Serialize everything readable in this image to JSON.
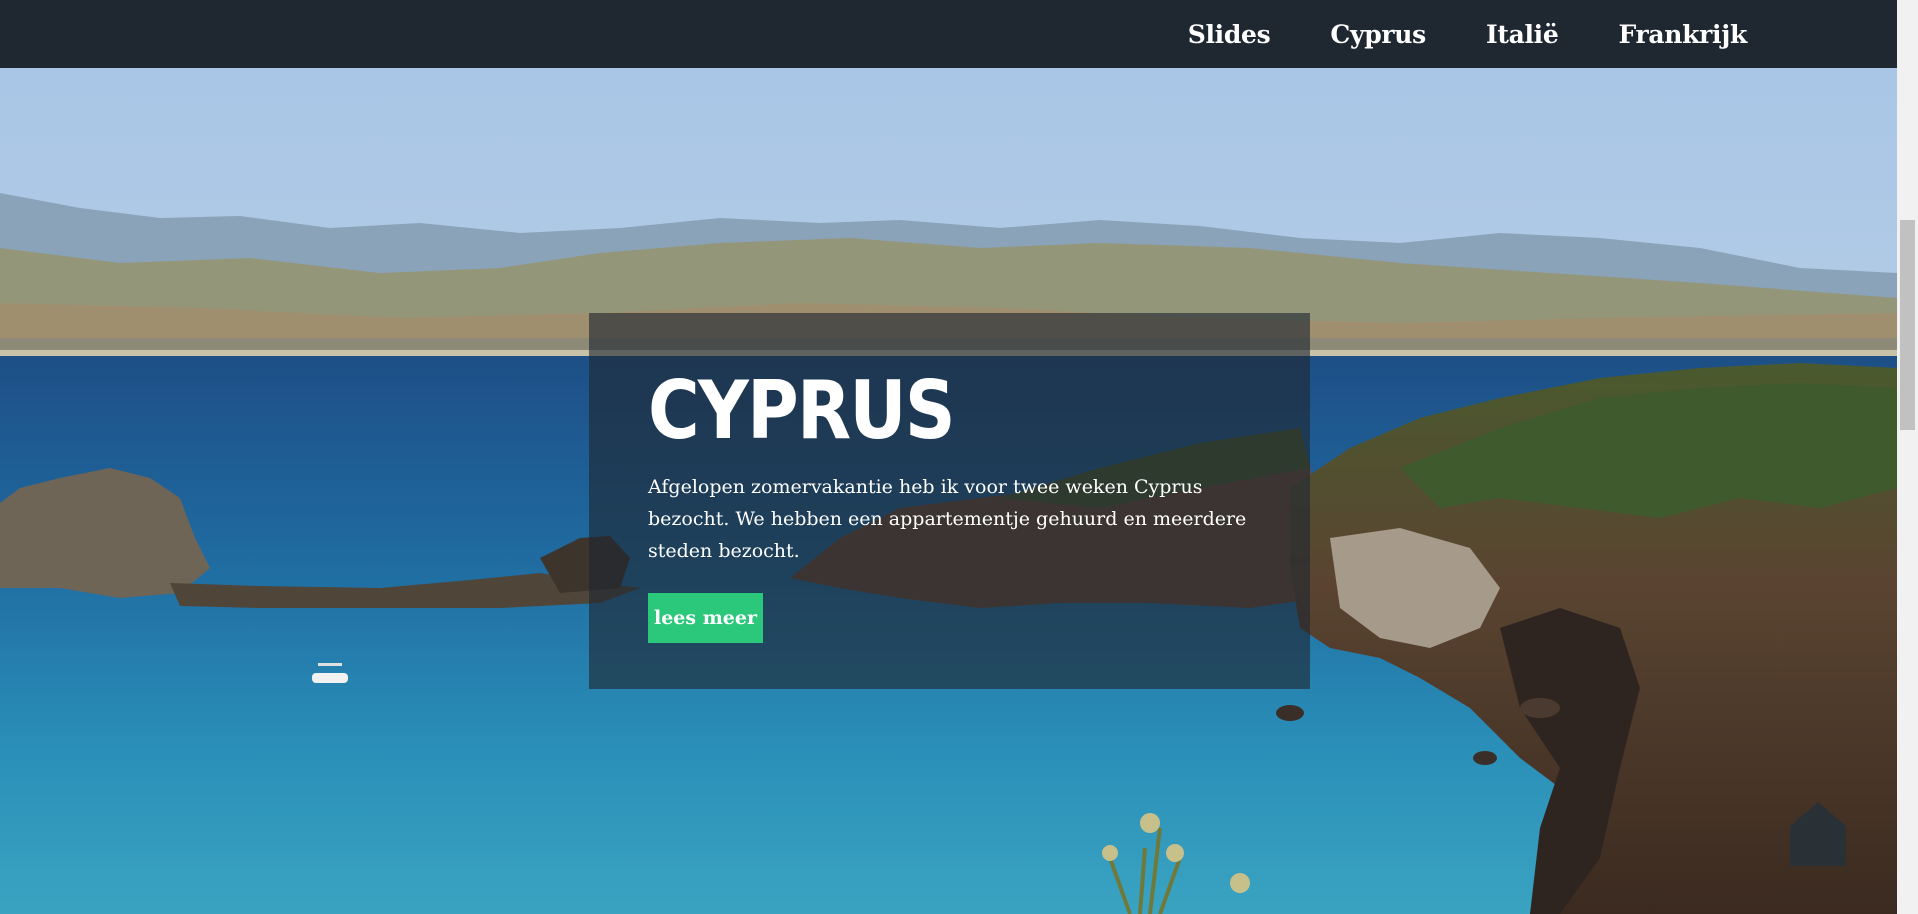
{
  "nav": {
    "items": [
      {
        "label": "Slides"
      },
      {
        "label": "Cyprus"
      },
      {
        "label": "Italië"
      },
      {
        "label": "Frankrijk"
      }
    ]
  },
  "hero": {
    "title": "CYPRUS",
    "text": "Afgelopen zomervakantie heb ik voor twee weken Cyprus bezocht. We hebben een appartementje gehuurd en meerdere steden bezocht.",
    "button_label": "lees meer"
  },
  "colors": {
    "navbar": "#1f2730",
    "button": "#2bc77a",
    "card_overlay": "rgba(31,39,48,0.62)"
  },
  "icons": {
    "back_to_top": "home-arrow-icon"
  }
}
